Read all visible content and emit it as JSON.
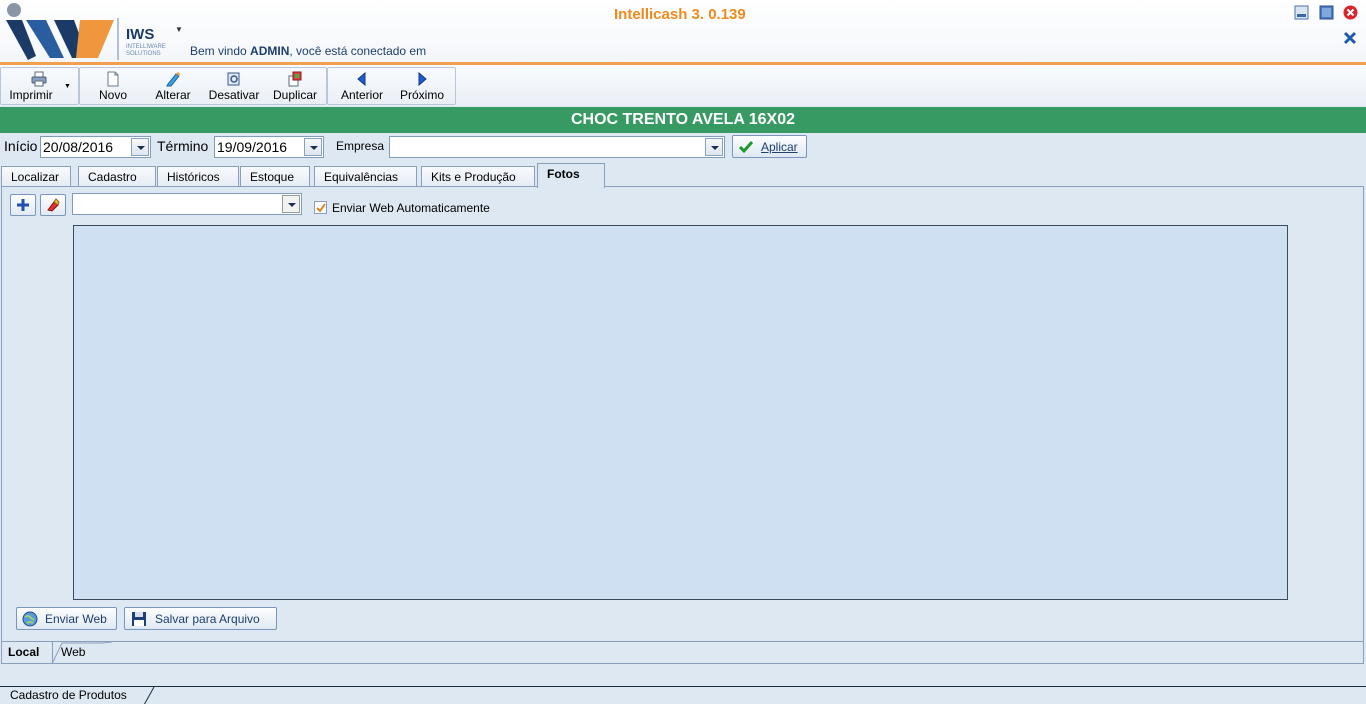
{
  "app": {
    "title": "Intellicash 3. 0.139"
  },
  "logo": {
    "name": "IWS",
    "subtitle": "INTELLIWARE SOLUTIONS"
  },
  "welcome": {
    "prefix": "Bem vindo ",
    "user": "ADMIN",
    "suffix": ", você está conectado em"
  },
  "toolbar": {
    "print": "Imprimir",
    "new": "Novo",
    "edit": "Alterar",
    "deactivate": "Desativar",
    "duplicate": "Duplicar",
    "previous": "Anterior",
    "next": "Próximo"
  },
  "product": {
    "title": "CHOC TRENTO AVELA 16X02"
  },
  "filters": {
    "start_label": "Início",
    "start_value": "20/08/2016",
    "end_label": "Término",
    "end_value": "19/09/2016",
    "company_label": "Empresa",
    "company_value": "",
    "apply_label": "Aplicar"
  },
  "tabs": [
    {
      "label": "Localizar"
    },
    {
      "label": "Cadastro"
    },
    {
      "label": "Históricos"
    },
    {
      "label": "Estoque"
    },
    {
      "label": "Equivalências"
    },
    {
      "label": "Kits e Produção"
    },
    {
      "label": "Fotos"
    }
  ],
  "photos": {
    "select_value": "",
    "auto_send_label": "Enviar Web Automaticamente",
    "auto_send_checked": true,
    "send_web_label": "Enviar Web",
    "save_file_label": "Salvar para Arquivo"
  },
  "bottom_tabs": [
    {
      "label": "Local"
    },
    {
      "label": "Web"
    }
  ],
  "status": {
    "window_tab": "Cadastro de Produtos"
  },
  "colors": {
    "accent_orange": "#f08a1c",
    "title_bar_green": "#369a62",
    "photo_bg": "#cfe0f3"
  }
}
